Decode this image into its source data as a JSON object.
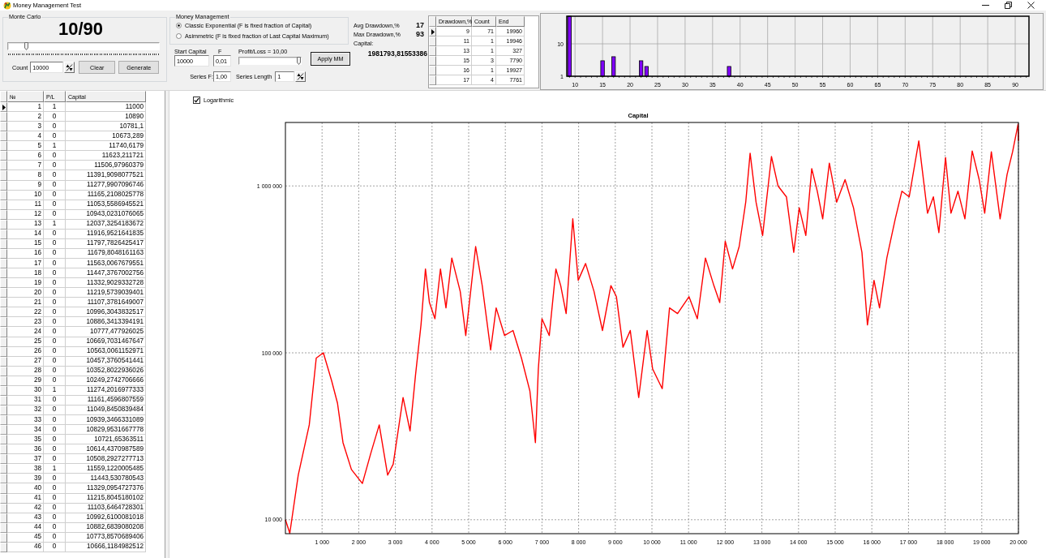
{
  "window": {
    "title": "Money Management Test"
  },
  "monte_carlo": {
    "title": "Monte Carlo",
    "progress": "10/90",
    "slider": {
      "level": 0.11
    },
    "count": {
      "label": "Count",
      "value": "10000"
    },
    "buttons": [
      "Clear",
      "Generate"
    ]
  },
  "money_management": {
    "title": "Money Management",
    "options": [
      {
        "label": "Classic Exponential (F is fixed fraction of Capital)",
        "selected": true
      },
      {
        "label": "Asimmetric (F is fixed fraction of Last Capital Maximum)",
        "selected": false
      }
    ]
  },
  "parameters": {
    "start_capital": {
      "label": "Start Capital",
      "value": "10000"
    },
    "f": {
      "label": "F",
      "value": "0,01"
    },
    "profit_loss": {
      "label": "Profit/Loss = 10,00",
      "level": 1
    },
    "apply_button": "Apply MM",
    "series_f": {
      "label": "Series F:",
      "value": "1,00"
    },
    "series_length": {
      "label": "Series Length",
      "value": "1"
    }
  },
  "statistics": {
    "items": [
      {
        "label": "Avg Drawdown,%",
        "value": "17"
      },
      {
        "label": "Max Drawdown,%",
        "value": "93"
      }
    ],
    "capital": {
      "label": "Capital:",
      "value": "1981793,81553386"
    }
  },
  "drawdown_table": {
    "columns": [
      "Drawdown,%",
      "Count",
      "End"
    ],
    "rows": [
      {
        "cells": [
          "9",
          "71",
          "19960"
        ],
        "selected": true
      },
      {
        "cells": [
          "11",
          "1",
          "19946"
        ],
        "selected": false
      },
      {
        "cells": [
          "13",
          "1",
          "327"
        ],
        "selected": false
      },
      {
        "cells": [
          "15",
          "3",
          "7790"
        ],
        "selected": false
      },
      {
        "cells": [
          "16",
          "1",
          "19927"
        ],
        "selected": false
      },
      {
        "cells": [
          "17",
          "4",
          "7761"
        ],
        "selected": false
      }
    ]
  },
  "drawdown_histogram": {
    "chart_data": [
      {
        "type": "bar",
        "x": [
          9,
          15,
          17,
          22,
          23,
          38
        ],
        "values": [
          71,
          3,
          4,
          3,
          2,
          2
        ],
        "color": "#8000ff",
        "log": true,
        "xlim": [
          8.5,
          92.5
        ],
        "ylim": [
          1,
          71
        ],
        "xticks": [
          10,
          15,
          20,
          25,
          30,
          35,
          40,
          45,
          50,
          55,
          60,
          65,
          70,
          75,
          80,
          85,
          90
        ],
        "yticks": [
          1,
          10
        ],
        "grid": true
      }
    ]
  },
  "trades_table": {
    "columns": [
      "№",
      "P/L",
      "Capital"
    ],
    "rows": [
      {
        "cells": [
          "1",
          "1",
          "11000"
        ],
        "selected": true
      },
      {
        "cells": [
          "2",
          "0",
          "10890"
        ],
        "selected": false
      },
      {
        "cells": [
          "3",
          "0",
          "10781,1"
        ],
        "selected": false
      },
      {
        "cells": [
          "4",
          "0",
          "10673,289"
        ],
        "selected": false
      },
      {
        "cells": [
          "5",
          "1",
          "11740,6179"
        ],
        "selected": false
      },
      {
        "cells": [
          "6",
          "0",
          "11623,211721"
        ],
        "selected": false
      },
      {
        "cells": [
          "7",
          "0",
          "11506,97960379"
        ],
        "selected": false
      },
      {
        "cells": [
          "8",
          "0",
          "11391,9098077521"
        ],
        "selected": false
      },
      {
        "cells": [
          "9",
          "0",
          "11277,9907096746"
        ],
        "selected": false
      },
      {
        "cells": [
          "10",
          "0",
          "11165,2108025778"
        ],
        "selected": false
      },
      {
        "cells": [
          "11",
          "0",
          "11053,5586945521"
        ],
        "selected": false
      },
      {
        "cells": [
          "12",
          "0",
          "10943,0231076065"
        ],
        "selected": false
      },
      {
        "cells": [
          "13",
          "1",
          "12037,3254183672"
        ],
        "selected": false
      },
      {
        "cells": [
          "14",
          "0",
          "11916,9521641835"
        ],
        "selected": false
      },
      {
        "cells": [
          "15",
          "0",
          "11797,7826425417"
        ],
        "selected": false
      },
      {
        "cells": [
          "16",
          "0",
          "11679,8048161163"
        ],
        "selected": false
      },
      {
        "cells": [
          "17",
          "0",
          "11563,0067679551"
        ],
        "selected": false
      },
      {
        "cells": [
          "18",
          "0",
          "11447,3767002756"
        ],
        "selected": false
      },
      {
        "cells": [
          "19",
          "0",
          "11332,9029332728"
        ],
        "selected": false
      },
      {
        "cells": [
          "20",
          "0",
          "11219,5739039401"
        ],
        "selected": false
      },
      {
        "cells": [
          "21",
          "0",
          "11107,3781649007"
        ],
        "selected": false
      },
      {
        "cells": [
          "22",
          "0",
          "10996,3043832517"
        ],
        "selected": false
      },
      {
        "cells": [
          "23",
          "0",
          "10886,3413394191"
        ],
        "selected": false
      },
      {
        "cells": [
          "24",
          "0",
          "10777,477926025"
        ],
        "selected": false
      },
      {
        "cells": [
          "25",
          "0",
          "10669,7031467647"
        ],
        "selected": false
      },
      {
        "cells": [
          "26",
          "0",
          "10563,0061152971"
        ],
        "selected": false
      },
      {
        "cells": [
          "27",
          "0",
          "10457,3760541441"
        ],
        "selected": false
      },
      {
        "cells": [
          "28",
          "0",
          "10352,8022936026"
        ],
        "selected": false
      },
      {
        "cells": [
          "29",
          "0",
          "10249,2742706666"
        ],
        "selected": false
      },
      {
        "cells": [
          "30",
          "1",
          "11274,2016977333"
        ],
        "selected": false
      },
      {
        "cells": [
          "31",
          "0",
          "11161,4596807559"
        ],
        "selected": false
      },
      {
        "cells": [
          "32",
          "0",
          "11049,8450839484"
        ],
        "selected": false
      },
      {
        "cells": [
          "33",
          "0",
          "10939,3466331089"
        ],
        "selected": false
      },
      {
        "cells": [
          "34",
          "0",
          "10829,9531667778"
        ],
        "selected": false
      },
      {
        "cells": [
          "35",
          "0",
          "10721,65363511"
        ],
        "selected": false
      },
      {
        "cells": [
          "36",
          "0",
          "10614,4370987589"
        ],
        "selected": false
      },
      {
        "cells": [
          "37",
          "0",
          "10508,2927277713"
        ],
        "selected": false
      },
      {
        "cells": [
          "38",
          "1",
          "11559,1220005485"
        ],
        "selected": false
      },
      {
        "cells": [
          "39",
          "0",
          "11443,530780543"
        ],
        "selected": false
      },
      {
        "cells": [
          "40",
          "0",
          "11329,0954727376"
        ],
        "selected": false
      },
      {
        "cells": [
          "41",
          "0",
          "11215,8045180102"
        ],
        "selected": false
      },
      {
        "cells": [
          "42",
          "0",
          "11103,6464728301"
        ],
        "selected": false
      },
      {
        "cells": [
          "43",
          "0",
          "10992,6100081018"
        ],
        "selected": false
      },
      {
        "cells": [
          "44",
          "0",
          "10882,6839080208"
        ],
        "selected": false
      },
      {
        "cells": [
          "45",
          "0",
          "10773,8570689406"
        ],
        "selected": false
      },
      {
        "cells": [
          "46",
          "0",
          "10666,1184982512"
        ],
        "selected": false
      }
    ]
  },
  "capital_chart": {
    "logarithmic": {
      "label": "Logarithmic",
      "checked": true
    },
    "chart_data": [
      {
        "type": "line",
        "title": "Capital",
        "x": [
          0,
          120,
          350,
          650,
          840,
          1035,
          1260,
          1420,
          1570,
          1800,
          2100,
          2330,
          2560,
          2790,
          2940,
          3210,
          3400,
          3550,
          3700,
          3820,
          3930,
          4080,
          4230,
          4380,
          4540,
          4770,
          4920,
          5190,
          5370,
          5600,
          5750,
          5980,
          6210,
          6440,
          6670,
          6820,
          6900,
          7000,
          7200,
          7380,
          7510,
          7660,
          7840,
          7990,
          8190,
          8420,
          8650,
          8880,
          9030,
          9210,
          9410,
          9640,
          9870,
          10020,
          10280,
          10480,
          10700,
          11010,
          11240,
          11460,
          11690,
          11850,
          12000,
          12200,
          12380,
          12560,
          12680,
          12840,
          13020,
          13260,
          13440,
          13670,
          13870,
          14020,
          14200,
          14360,
          14510,
          14660,
          14840,
          15040,
          15270,
          15500,
          15730,
          15880,
          16060,
          16210,
          16410,
          16640,
          16820,
          17020,
          17280,
          17520,
          17680,
          17830,
          18010,
          18160,
          18350,
          18540,
          18740,
          18930,
          19080,
          19260,
          19500,
          19690,
          19840,
          19990,
          20000
        ],
        "values": [
          10000,
          8300,
          18500,
          37000,
          93000,
          100000,
          68000,
          50000,
          29000,
          20000,
          16500,
          25000,
          37000,
          18500,
          21500,
          54000,
          34000,
          74000,
          147000,
          318000,
          200000,
          160000,
          318000,
          186000,
          370000,
          233000,
          127000,
          433000,
          253000,
          104000,
          186000,
          127000,
          136000,
          93000,
          59000,
          29000,
          80000,
          160000,
          127000,
          318000,
          253000,
          172000,
          635000,
          272000,
          343000,
          233000,
          136000,
          253000,
          217000,
          108000,
          136000,
          54000,
          136000,
          80000,
          61000,
          186000,
          172000,
          217000,
          160000,
          370000,
          253000,
          200000,
          466000,
          318000,
          433000,
          800000,
          1570000,
          800000,
          505000,
          1500000,
          1000000,
          860000,
          400000,
          740000,
          505000,
          1270000,
          930000,
          635000,
          1370000,
          800000,
          1090000,
          740000,
          400000,
          147000,
          272000,
          186000,
          370000,
          635000,
          930000,
          860000,
          1860000,
          686000,
          860000,
          525000,
          1480000,
          686000,
          930000,
          635000,
          1620000,
          1090000,
          686000,
          1600000,
          635000,
          1170000,
          1600000,
          2340000,
          1860000
        ],
        "color": "#ff0000",
        "log": true,
        "xlim": [
          0,
          20000
        ],
        "ylim": [
          8250,
          2400000
        ],
        "xticks": [
          {
            "value": 1000,
            "label": "1 000"
          },
          {
            "value": 2000,
            "label": "2 000"
          },
          {
            "value": 3000,
            "label": "3 000"
          },
          {
            "value": 4000,
            "label": "4 000"
          },
          {
            "value": 5000,
            "label": "5 000"
          },
          {
            "value": 6000,
            "label": "6 000"
          },
          {
            "value": 7000,
            "label": "7 000"
          },
          {
            "value": 8000,
            "label": "8 000"
          },
          {
            "value": 9000,
            "label": "9 000"
          },
          {
            "value": 10000,
            "label": "10 000"
          },
          {
            "value": 11000,
            "label": "11 000"
          },
          {
            "value": 12000,
            "label": "12 000"
          },
          {
            "value": 13000,
            "label": "13 000"
          },
          {
            "value": 14000,
            "label": "14 000"
          },
          {
            "value": 15000,
            "label": "15 000"
          },
          {
            "value": 16000,
            "label": "16 000"
          },
          {
            "value": 17000,
            "label": "17 000"
          },
          {
            "value": 18000,
            "label": "18 000"
          },
          {
            "value": 19000,
            "label": "19 000"
          },
          {
            "value": 20000,
            "label": "20 000"
          }
        ],
        "yticks": [
          {
            "value": 10000,
            "label": "10 000"
          },
          {
            "value": 100000,
            "label": "100 000"
          },
          {
            "value": 1000000,
            "label": "1 000 000"
          }
        ],
        "grid": true
      }
    ]
  }
}
